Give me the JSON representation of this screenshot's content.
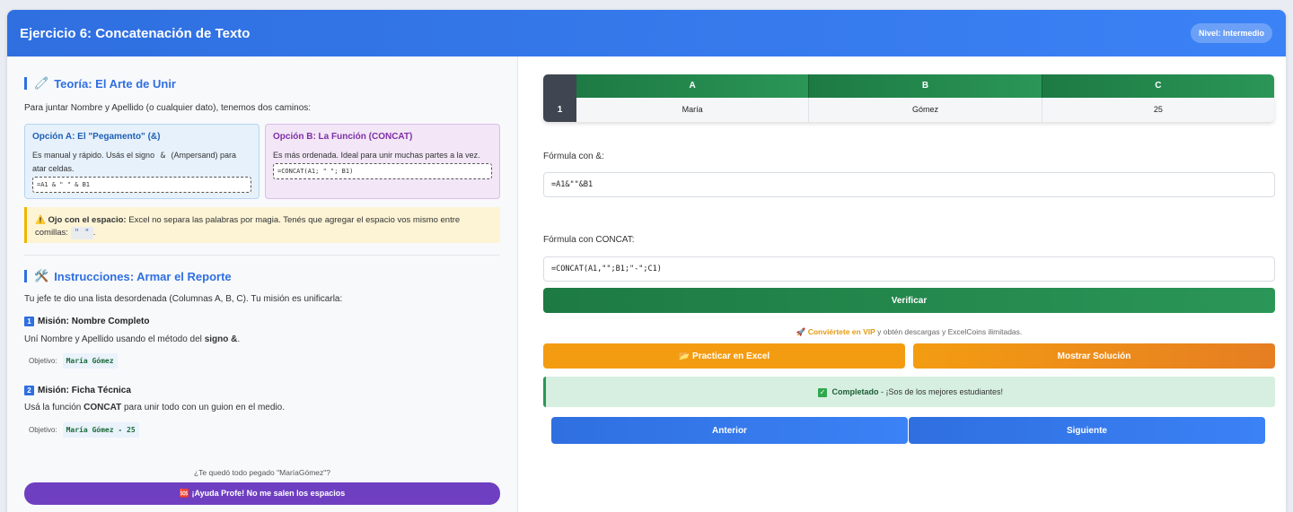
{
  "header": {
    "title": "Ejercicio 6: Concatenación de Texto",
    "level": "Nivel: Intermedio"
  },
  "theory": {
    "icon": "🧷",
    "title": "Teoría: El Arte de Unir",
    "intro": "Para juntar Nombre y Apellido (o cualquier dato), tenemos dos caminos:",
    "option_a": {
      "title": "Opción A: El \"Pegamento\" (&)",
      "desc_before": "Es manual y rápido. Usás el signo",
      "amp": "&",
      "desc_after": "(Ampersand) para atar celdas.",
      "code": "=A1 & \" \" & B1"
    },
    "option_b": {
      "title": "Opción B: La Función (CONCAT)",
      "desc": "Es más ordenada. Ideal para unir muchas partes a la vez.",
      "code": "=CONCAT(A1; \" \"; B1)"
    },
    "warning": {
      "icon": "⚠️",
      "bold": "Ojo con el espacio:",
      "text": " Excel no separa las palabras por magia. Tenés que agregar el espacio vos mismo entre comillas:",
      "code": "\" \"",
      "end": "."
    }
  },
  "instructions": {
    "icon": "🛠️",
    "title": "Instrucciones: Armar el Reporte",
    "intro": "Tu jefe te dio una lista desordenada (Columnas A, B, C). Tu misión es unificarla:",
    "mission1": {
      "num": "1",
      "title": "Misión: Nombre Completo",
      "desc_before": "Uní Nombre y Apellido usando el método del ",
      "desc_bold": "signo &",
      "desc_after": ".",
      "obj_label": "Objetivo:",
      "obj_value": "María Gómez"
    },
    "mission2": {
      "num": "2",
      "title": "Misión: Ficha Técnica",
      "desc_before": "Usá la función ",
      "desc_bold": "CONCAT",
      "desc_after": " para unir todo con un guion en el medio.",
      "obj_label": "Objetivo:",
      "obj_value": "María Gómez - 25"
    },
    "stuck": "¿Te quedó todo pegado \"MaríaGómez\"?",
    "help_button": "🆘 ¡Ayuda Profe! No me salen los espacios"
  },
  "sheet": {
    "columns": [
      "A",
      "B",
      "C"
    ],
    "row_number": "1",
    "cells": [
      "María",
      "Gómez",
      "25"
    ]
  },
  "formula1": {
    "label": "Fórmula con &:",
    "value": "=A1&\"\"&B1"
  },
  "formula2": {
    "label": "Fórmula con CONCAT:",
    "value": "=CONCAT(A1,\"\";B1;\"-\";C1)"
  },
  "verify_button": "Verificar",
  "vip": {
    "icon": "🚀",
    "link": "Conviértete en VIP",
    "text": " y obtén descargas y ExcelCoins ilimitadas."
  },
  "practice_button": "📂 Practicar en Excel",
  "solution_button": "Mostrar Solución",
  "completed": {
    "check": "✓",
    "bold": "Completado",
    "text": " - ¡Sos de los mejores estudiantes!"
  },
  "nav": {
    "prev": "Anterior",
    "next": "Siguiente"
  }
}
